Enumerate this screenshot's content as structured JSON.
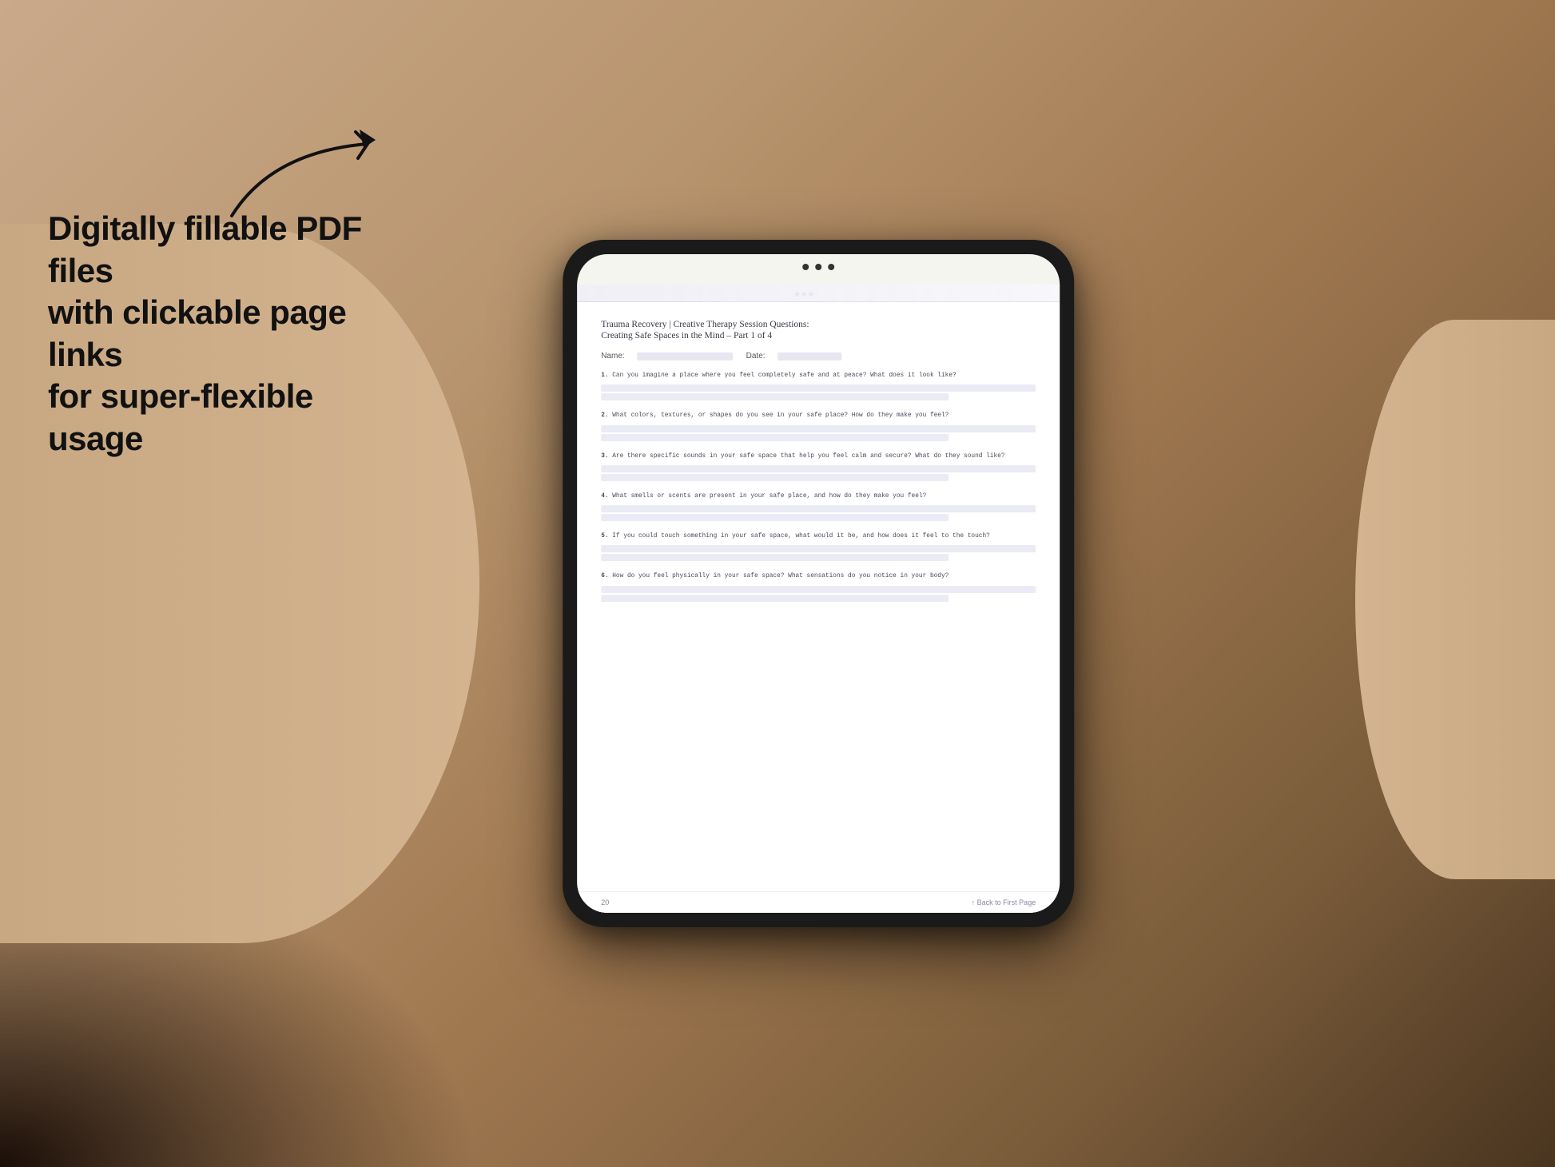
{
  "background": {
    "color_start": "#c9a98a",
    "color_end": "#4a3520"
  },
  "left_text": {
    "line1": "Digitally fillable PDF files",
    "line2": "with clickable page links",
    "line3": "for super-flexible usage"
  },
  "arrow": {
    "label": "arrow pointing right"
  },
  "tablet": {
    "camera_dots": 3
  },
  "pdf": {
    "title": "Trauma Recovery | Creative Therapy Session Questions:",
    "subtitle": "Creating Safe Spaces in the Mind  – Part 1 of 4",
    "name_label": "Name:",
    "date_label": "Date:",
    "questions": [
      {
        "number": "1.",
        "text": "Can you imagine a place where you feel completely safe and at peace? What does it look like?"
      },
      {
        "number": "2.",
        "text": "What colors, textures, or shapes do you see in your safe place? How do they make you feel?"
      },
      {
        "number": "3.",
        "text": "Are there specific sounds in your safe space that help you feel calm and secure? What do they sound like?"
      },
      {
        "number": "4.",
        "text": "What smells or scents are present in your safe place, and how do they make you feel?"
      },
      {
        "number": "5.",
        "text": "If you could touch something in your safe space, what would it be, and how does it feel to the touch?"
      },
      {
        "number": "6.",
        "text": "How do you feel physically in your safe space? What sensations do you notice in your body?"
      }
    ],
    "page_number": "20",
    "back_link": "↑ Back to First Page"
  }
}
